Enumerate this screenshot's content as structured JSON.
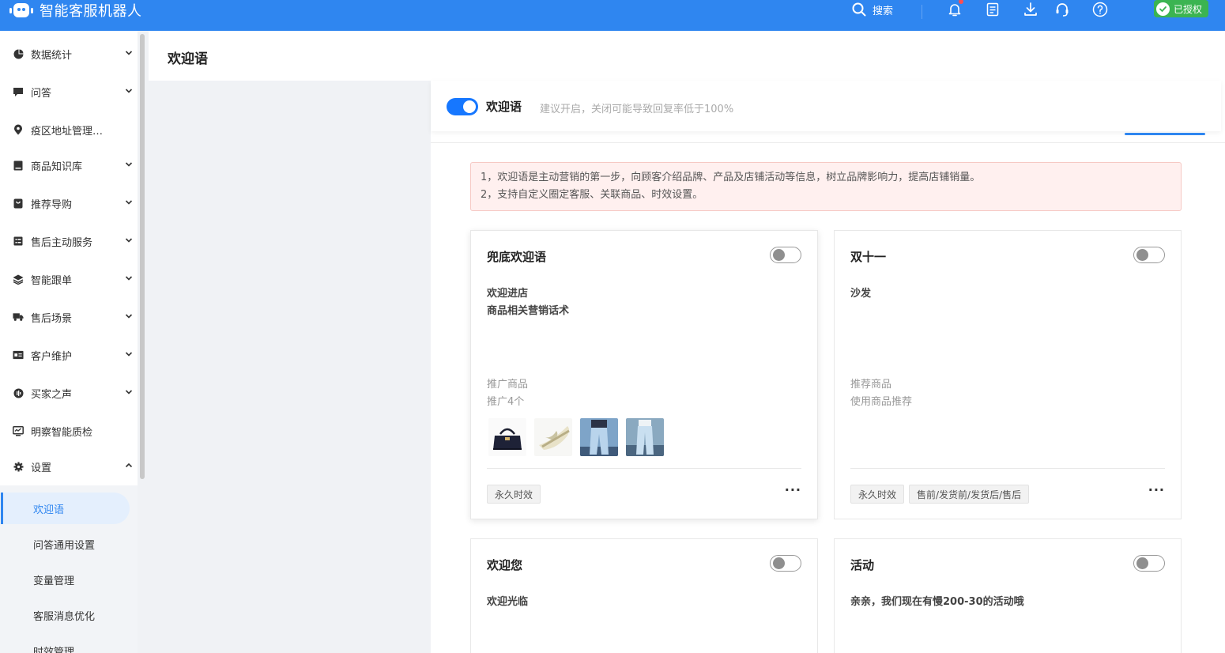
{
  "app": {
    "title": "智能客服机器人"
  },
  "topbar": {
    "search_label": "搜索",
    "icons": [
      "bell-icon",
      "document-icon",
      "download-icon",
      "headset-icon",
      "help-icon"
    ],
    "auth_label": "已授权",
    "colors": {
      "bar": "#2f86f0",
      "auth": "#3bb451",
      "notify_dot": "#ff4d4f"
    }
  },
  "sidebar": {
    "items": [
      {
        "label": "数据统计",
        "icon": "pie-chart-icon"
      },
      {
        "label": "问答",
        "icon": "chat-icon"
      },
      {
        "label": "疫区地址管理…",
        "icon": "location-icon"
      },
      {
        "label": "商品知识库",
        "icon": "book-icon"
      },
      {
        "label": "推荐导购",
        "icon": "bag-icon"
      },
      {
        "label": "售后主动服务",
        "icon": "list-icon"
      },
      {
        "label": "智能跟单",
        "icon": "layers-icon"
      },
      {
        "label": "售后场景",
        "icon": "truck-icon"
      },
      {
        "label": "客户维护",
        "icon": "id-card-icon"
      },
      {
        "label": "买家之声",
        "icon": "voice-icon"
      },
      {
        "label": "明察智能质检",
        "icon": "monitor-icon"
      },
      {
        "label": "设置",
        "icon": "gear-icon"
      }
    ],
    "settings_sub": [
      {
        "label": "欢迎语",
        "active": true
      },
      {
        "label": "问答通用设置"
      },
      {
        "label": "变量管理"
      },
      {
        "label": "客服消息优化"
      },
      {
        "label": "时效管理"
      }
    ]
  },
  "page": {
    "title": "欢迎语",
    "toggle_label": "欢迎语",
    "toggle_hint": "建议开启，关闭可能导致回复率低于100%",
    "toggle_on": true,
    "notice": [
      "1，欢迎语是主动营销的第一步，向顾客介绍品牌、产品及店铺活动等信息，树立品牌影响力，提高店铺销量。",
      "2，支持自定义圈定客服、关联商品、时效设置。"
    ]
  },
  "cards": [
    {
      "title": "兜底欢迎语",
      "lines": [
        "欢迎进店",
        "商品相关营销话术"
      ],
      "product_label": "推广商品",
      "product_value": "推广4个",
      "thumbs": [
        "handbag-image",
        "sandal-image",
        "jeans-image",
        "trousers-image"
      ],
      "tags": [
        "永久时效"
      ],
      "enabled": false
    },
    {
      "title": "双十一",
      "lines": [
        "沙发"
      ],
      "product_label": "推荐商品",
      "product_value": "使用商品推荐",
      "tags": [
        "永久时效",
        "售前/发货前/发货后/售后"
      ],
      "enabled": false
    },
    {
      "title": "欢迎您",
      "lines": [
        "欢迎光临"
      ],
      "enabled": false
    },
    {
      "title": "活动",
      "lines": [
        "亲亲，我们现在有慢200-30的活动哦"
      ],
      "enabled": false
    }
  ]
}
